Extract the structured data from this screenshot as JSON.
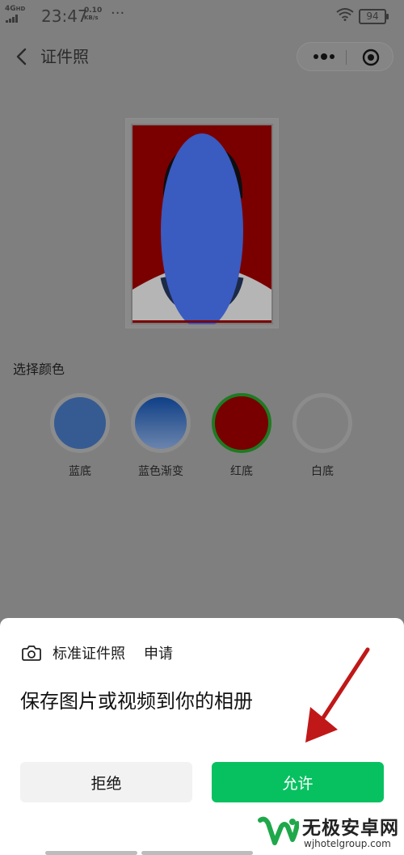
{
  "status_bar": {
    "network": "4G",
    "network_sub": "HD",
    "time": "23:47",
    "speed_value": "0.10",
    "speed_unit": "KB/s",
    "more": "···",
    "battery": "94"
  },
  "nav": {
    "title": "证件照"
  },
  "photo": {
    "background_color": "#b30000",
    "face_mask_color": "#4169d8"
  },
  "color_section": {
    "label": "选择颜色",
    "options": [
      {
        "label": "蓝底",
        "color": "#3a5d92",
        "selected": false
      },
      {
        "label": "蓝色渐变",
        "color": "#2d5ca6",
        "selected": false
      },
      {
        "label": "红底",
        "color": "#780000",
        "selected": true
      },
      {
        "label": "白底",
        "color": "#808080",
        "selected": false
      }
    ]
  },
  "permission_sheet": {
    "app_name": "标准证件照",
    "request": "申请",
    "message": "保存图片或视频到你的相册",
    "deny_label": "拒绝",
    "allow_label": "允许"
  },
  "watermark": {
    "name": "无极安卓网",
    "url": "wjhotelgroup.com"
  },
  "colors": {
    "accent_green": "#07c160",
    "arrow_red": "#c01818"
  }
}
